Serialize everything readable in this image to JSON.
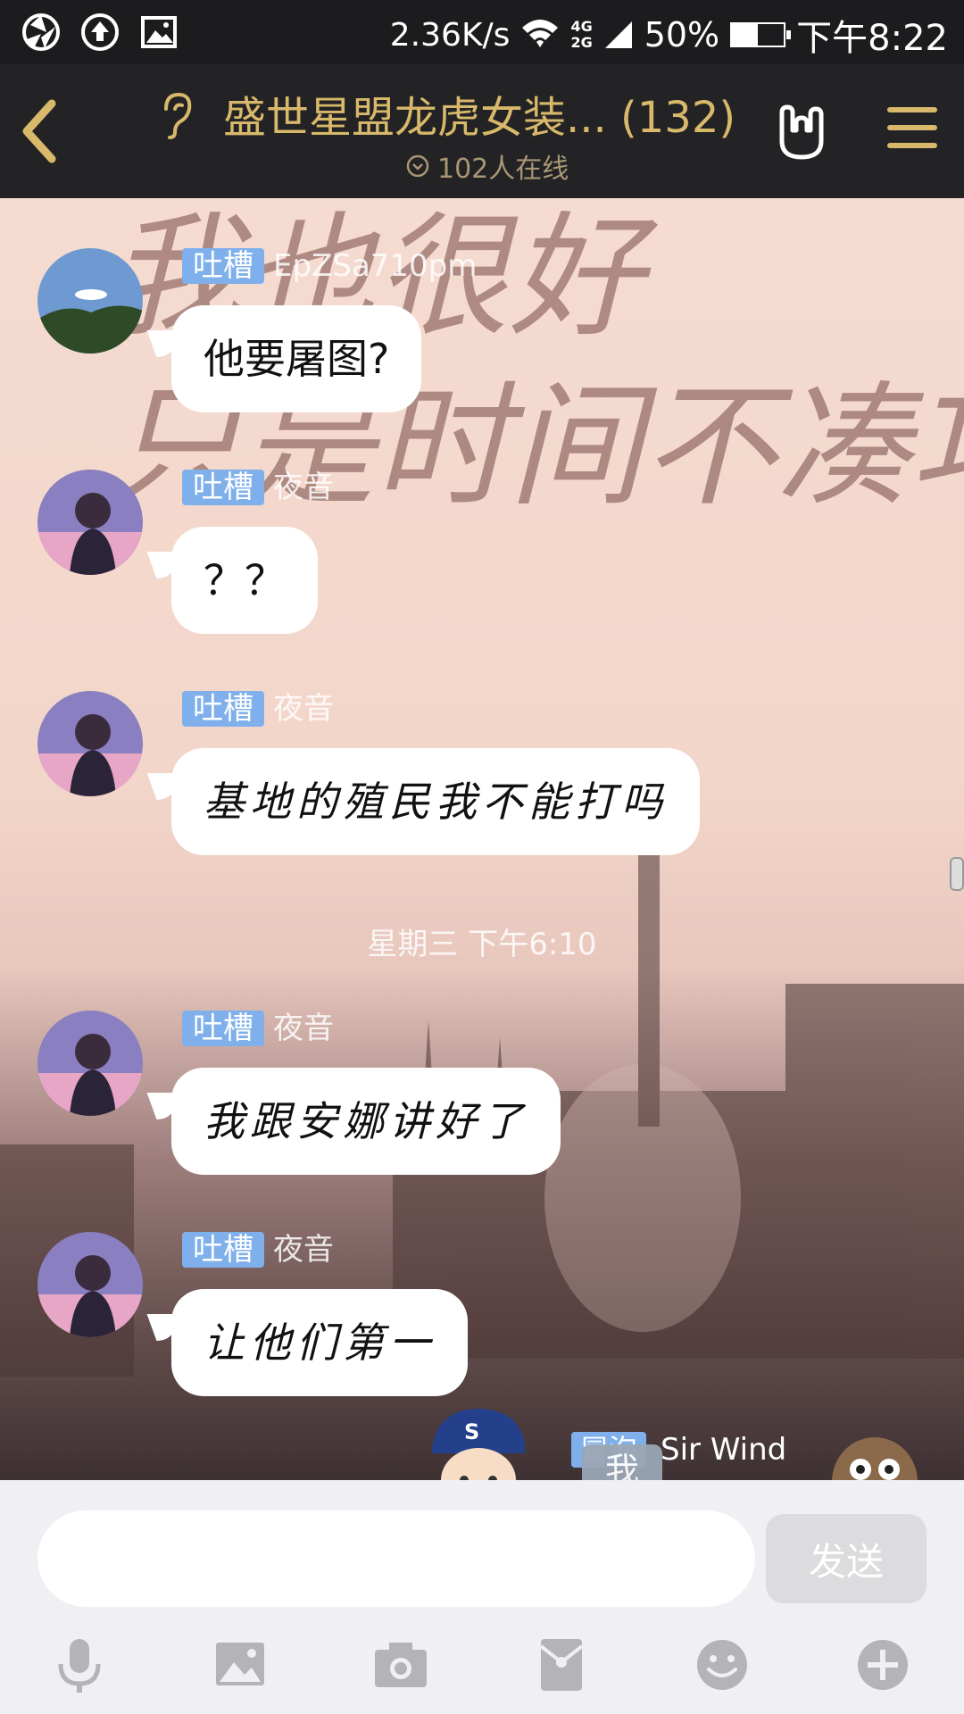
{
  "status_bar": {
    "network_speed": "2.36K/s",
    "network_type_top": "4G",
    "network_type_bottom": "2G",
    "battery_percent": "50%",
    "battery_level": 0.5,
    "time": "下午8:22"
  },
  "header": {
    "title": "盛世星盟龙虎女装... (132)",
    "online": "102人在线",
    "accent_color": "#d8b86a"
  },
  "messages": [
    {
      "tag": "吐槽",
      "nickname": "EpZSa710pm",
      "text": "他要屠图?"
    },
    {
      "tag": "吐槽",
      "nickname": "夜音",
      "text": "？？"
    },
    {
      "tag": "吐槽",
      "nickname": "夜音",
      "text": "基地的殖民我不能打吗"
    },
    {
      "tag": "吐槽",
      "nickname": "夜音",
      "text": "我跟安娜讲好了"
    },
    {
      "tag": "吐槽",
      "nickname": "夜音",
      "text": "让他们第一"
    }
  ],
  "timestamp": "星期三 下午6:10",
  "me_row": {
    "tag": "冒泡",
    "badge": "我",
    "name": "Sir Wind"
  },
  "input": {
    "value": "",
    "placeholder": "",
    "send_label": "发送"
  },
  "toolbar_icons": [
    "microphone-icon",
    "image-icon",
    "camera-icon",
    "red-packet-icon",
    "emoji-icon",
    "plus-icon"
  ]
}
